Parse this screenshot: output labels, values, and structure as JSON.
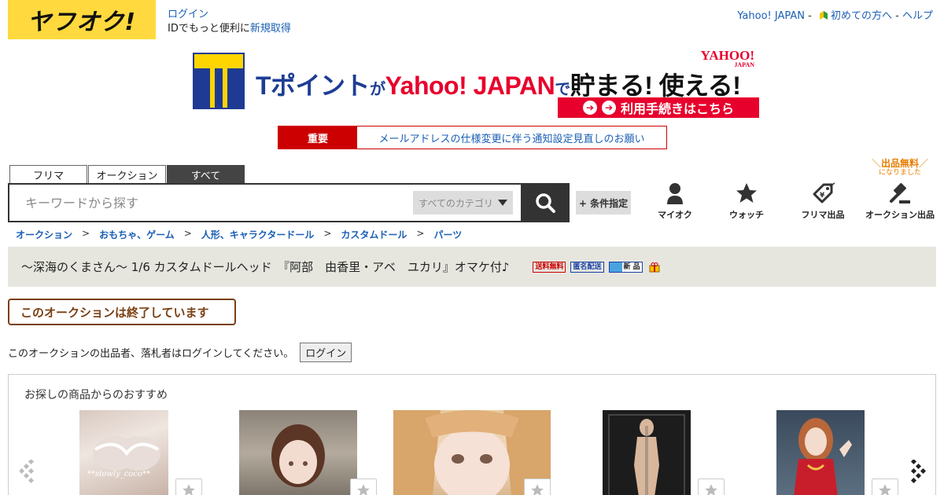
{
  "header": {
    "logo_text": "ヤフオク!",
    "login_label": "ログイン",
    "login_sub_prefix": "IDでもっと便利に",
    "signup_link": "新規取得",
    "yahoo_japan": "Yahoo! JAPAN",
    "sep": "-",
    "beginner": "初めての方へ",
    "help": "ヘルプ"
  },
  "banner": {
    "t_mark": "T",
    "text_tpoint": "Tポイント",
    "text_ga": "が",
    "text_yj": "Yahoo! JAPAN",
    "text_de": "で",
    "text_tamaru": "貯まる! 使える!",
    "yahoo_mini": "YAHOO!",
    "yahoo_mini_sub": "JAPAN",
    "cta": "利用手続きはこちら"
  },
  "notice": {
    "label": "重要",
    "text": "メールアドレスの仕様変更に伴う通知設定見直しのお願い"
  },
  "search": {
    "tabs": [
      {
        "label": "フリマ"
      },
      {
        "label": "オークション"
      },
      {
        "label": "すべて"
      }
    ],
    "placeholder": "キーワードから探す",
    "category": "すべてのカテゴリ",
    "condition_button": "+ 条件指定"
  },
  "shortcuts": {
    "myauction": "マイオク",
    "watch": "ウォッチ",
    "flea_listing": "フリマ出品",
    "auction_listing": "オークション出品",
    "free_label": "出品無料",
    "free_sub": "になりました"
  },
  "breadcrumb": [
    "オークション",
    "おもちゃ、ゲーム",
    "人形、キャラクタードール",
    "カスタムドール",
    "パーツ"
  ],
  "breadcrumb_sep": ">",
  "item": {
    "title": "～深海のくまさん～ 1/6 カスタムドールヘッド　『阿部　由香里・アベ　ユカリ』オマケ付♪",
    "badge_shipping": "送料無料",
    "badge_anon": "匿名配送",
    "badge_new": "新 品"
  },
  "status": {
    "ended": "このオークションは終了しています",
    "login_message": "このオークションの出品者、落札者はログインしてください。",
    "login_button": "ログイン"
  },
  "recommend": {
    "title": "お探しの商品からのおすすめ",
    "watermark": "**slowly_coco**"
  },
  "colors": {
    "brand_yellow": "#ffd93d",
    "link_blue": "#1a5fb4",
    "notice_red": "#cc0000",
    "ended_brown": "#7a3f12",
    "title_bar": "#e6e6df"
  }
}
